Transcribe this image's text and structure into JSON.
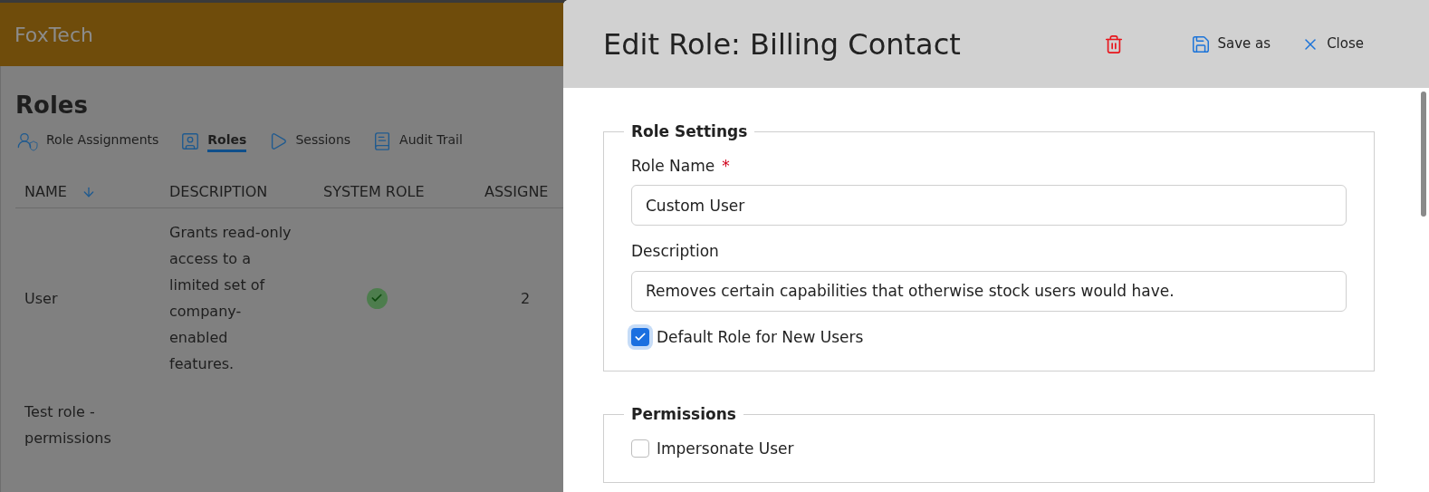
{
  "app": {
    "brand": "FoxTech"
  },
  "page": {
    "title": "Roles",
    "tabs": [
      {
        "label": "Role Assignments",
        "selected": false
      },
      {
        "label": "Roles",
        "selected": true
      },
      {
        "label": "Sessions",
        "selected": false
      },
      {
        "label": "Audit Trail",
        "selected": false
      }
    ],
    "table": {
      "columns": [
        {
          "label": "NAME",
          "sorted": true
        },
        {
          "label": "DESCRIPTION",
          "sorted": false
        },
        {
          "label": "SYSTEM ROLE",
          "sorted": false
        },
        {
          "label": "ASSIGNE",
          "sorted": false
        }
      ],
      "rows": [
        {
          "name": "User",
          "description": "Grants read-only access to a limited set of company-enabled features.",
          "system_role": true,
          "assigned": "2"
        },
        {
          "name": "Test role - permissions",
          "description": "",
          "system_role": false,
          "assigned": ""
        }
      ]
    }
  },
  "panel": {
    "title": "Edit Role: Billing Contact",
    "actions": [
      {
        "kind": "delete"
      },
      {
        "kind": "save",
        "label": "Save as"
      },
      {
        "kind": "close",
        "label": "Close"
      }
    ],
    "sections": [
      {
        "legend": "Role Settings",
        "fields": [
          {
            "kind": "text",
            "label": "Role Name",
            "required_mark": "*",
            "value": "Custom User"
          },
          {
            "kind": "text",
            "label": "Description",
            "value": "Removes certain capabilities that otherwise stock users would have."
          },
          {
            "kind": "checkbox",
            "label": "Default Role for New Users",
            "checked": true
          }
        ]
      },
      {
        "legend": "Permissions",
        "fields": [
          {
            "kind": "checkbox",
            "label": "Impersonate User",
            "checked": false
          }
        ]
      }
    ]
  }
}
